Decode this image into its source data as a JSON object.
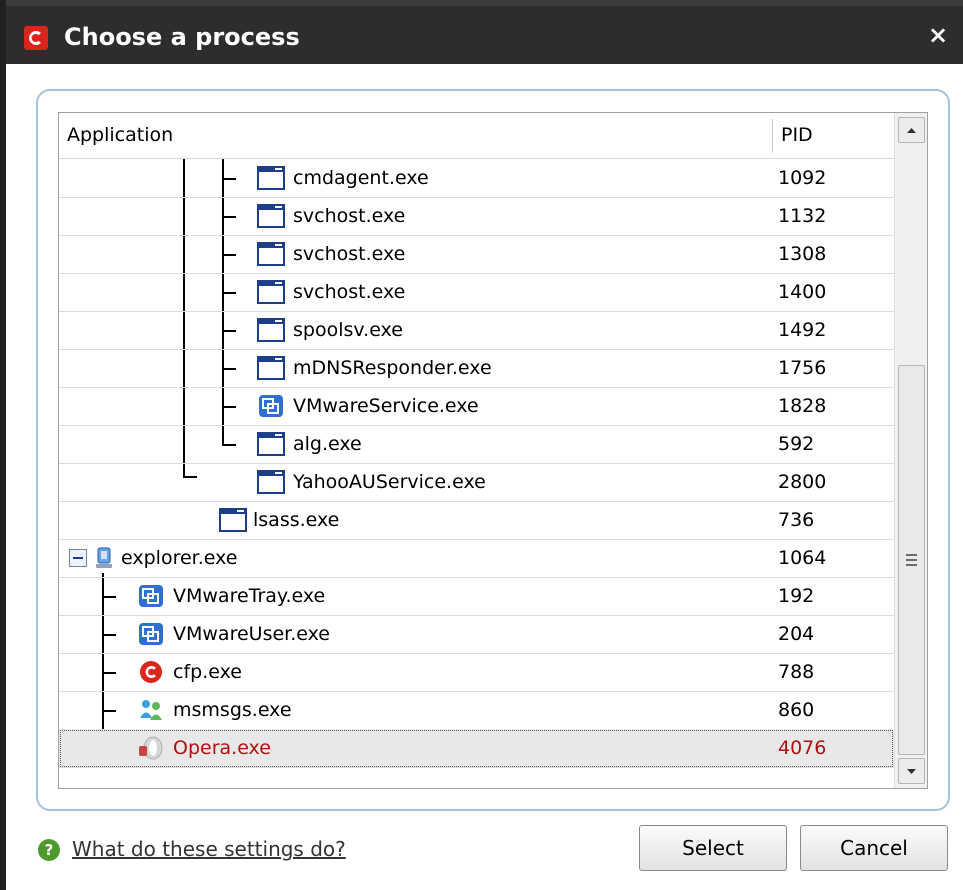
{
  "window": {
    "title": "Choose a process",
    "close_glyph": "×",
    "accent_color": "#2b2d2f"
  },
  "table": {
    "columns": {
      "application": "Application",
      "pid": "PID"
    },
    "rows": [
      {
        "name": "cmdagent.exe",
        "pid": "1092",
        "icon": "window-icon"
      },
      {
        "name": "svchost.exe",
        "pid": "1132",
        "icon": "window-icon"
      },
      {
        "name": "svchost.exe",
        "pid": "1308",
        "icon": "window-icon"
      },
      {
        "name": "svchost.exe",
        "pid": "1400",
        "icon": "window-icon"
      },
      {
        "name": "spoolsv.exe",
        "pid": "1492",
        "icon": "window-icon"
      },
      {
        "name": "mDNSResponder.exe",
        "pid": "1756",
        "icon": "window-icon"
      },
      {
        "name": "VMwareService.exe",
        "pid": "1828",
        "icon": "vmware-icon"
      },
      {
        "name": "alg.exe",
        "pid": "592",
        "icon": "window-icon"
      },
      {
        "name": "YahooAUService.exe",
        "pid": "2800",
        "icon": "window-icon"
      },
      {
        "name": "lsass.exe",
        "pid": "736",
        "icon": "window-icon"
      },
      {
        "name": "explorer.exe",
        "pid": "1064",
        "icon": "computer-icon"
      },
      {
        "name": "VMwareTray.exe",
        "pid": "192",
        "icon": "vmware-icon"
      },
      {
        "name": "VMwareUser.exe",
        "pid": "204",
        "icon": "vmware-icon"
      },
      {
        "name": "cfp.exe",
        "pid": "788",
        "icon": "comodo-icon"
      },
      {
        "name": "msmsgs.exe",
        "pid": "860",
        "icon": "messenger-icon"
      },
      {
        "name": "Opera.exe",
        "pid": "4076",
        "icon": "opera-icon",
        "selected": true
      }
    ]
  },
  "footer": {
    "help_text": "What do these settings do?",
    "select_label": "Select",
    "cancel_label": "Cancel"
  }
}
